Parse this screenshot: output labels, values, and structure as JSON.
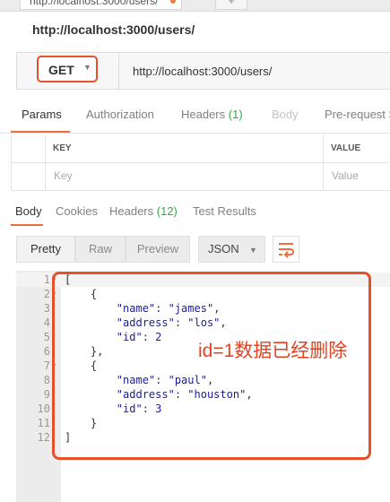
{
  "top_tab": {
    "label": "http://localhost:3000/users/"
  },
  "request": {
    "title": "http://localhost:3000/users/",
    "method": "GET",
    "url": "http://localhost:3000/users/"
  },
  "request_tabs": [
    {
      "label": "Params",
      "count": ""
    },
    {
      "label": "Authorization",
      "count": ""
    },
    {
      "label": "Headers",
      "count": "(1)"
    },
    {
      "label": "Body",
      "count": ""
    },
    {
      "label": "Pre-request S",
      "count": ""
    }
  ],
  "params_table": {
    "headers": [
      "KEY",
      "VALUE"
    ],
    "placeholders": [
      "Key",
      "Value"
    ]
  },
  "response_tabs": [
    {
      "label": "Body",
      "count": ""
    },
    {
      "label": "Cookies",
      "count": ""
    },
    {
      "label": "Headers",
      "count": "(12)"
    },
    {
      "label": "Test Results",
      "count": ""
    }
  ],
  "view_modes": [
    "Pretty",
    "Raw",
    "Preview"
  ],
  "format": "JSON",
  "icons": {
    "wrap": "wrap-lines-icon",
    "dropdown": "chevron-down-icon",
    "fold": "fold-triangle-icon"
  },
  "colors": {
    "accent": "#f26b3a",
    "annotation": "#e8401f",
    "count": "#3aa54a"
  },
  "code_lines": [
    {
      "num": "1",
      "text": "["
    },
    {
      "num": "2",
      "text": "    {"
    },
    {
      "num": "3",
      "text": "        \"name\": \"james\","
    },
    {
      "num": "4",
      "text": "        \"address\": \"los\","
    },
    {
      "num": "5",
      "text": "        \"id\": 2"
    },
    {
      "num": "6",
      "text": "    },"
    },
    {
      "num": "7",
      "text": "    {"
    },
    {
      "num": "8",
      "text": "        \"name\": \"paul\","
    },
    {
      "num": "9",
      "text": "        \"address\": \"houston\","
    },
    {
      "num": "10",
      "text": "        \"id\": 3"
    },
    {
      "num": "11",
      "text": "    }"
    },
    {
      "num": "12",
      "text": "]"
    }
  ],
  "annotation": "id=1数据已经删除"
}
